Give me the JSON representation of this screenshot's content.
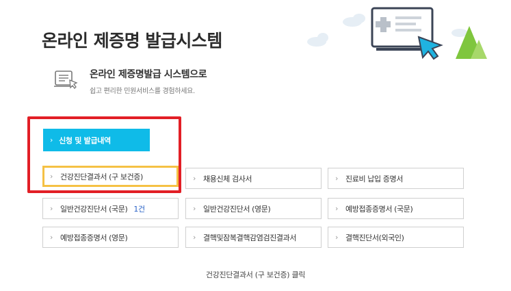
{
  "header": {
    "title": "온라인 제증명 발급시스템"
  },
  "intro": {
    "title": "온라인 제증명발급 시스템으로",
    "description": "쉽고 편리한 민원서비스를 경험하세요."
  },
  "tab": {
    "label": "신청 및 발급내역"
  },
  "documents": [
    {
      "label": "건강진단결과서 (구 보건증)",
      "count": ""
    },
    {
      "label": "채용신체 검사서",
      "count": ""
    },
    {
      "label": "진료비 납입 증명서",
      "count": ""
    },
    {
      "label": "일반건강진단서 (국문)",
      "count": "1건"
    },
    {
      "label": "일반건강진단서 (영문)",
      "count": ""
    },
    {
      "label": "예방접종증명서 (국문)",
      "count": ""
    },
    {
      "label": "예방접종증명서 (영문)",
      "count": ""
    },
    {
      "label": "결핵및잠복결핵감염검진결과서",
      "count": ""
    },
    {
      "label": "결핵진단서(외국인)",
      "count": ""
    }
  ],
  "caption": "건강진단결과서 (구 보건증) 클릭",
  "colors": {
    "accent": "#0fbbe8",
    "highlight_red": "#e21f26",
    "highlight_yellow": "#f5c144",
    "count_blue": "#2a63c7"
  },
  "icons": {
    "intro": "document-cursor-icon",
    "hero": "monitor-cursor-illustration",
    "cell_chevron": "chevron-right-icon"
  }
}
